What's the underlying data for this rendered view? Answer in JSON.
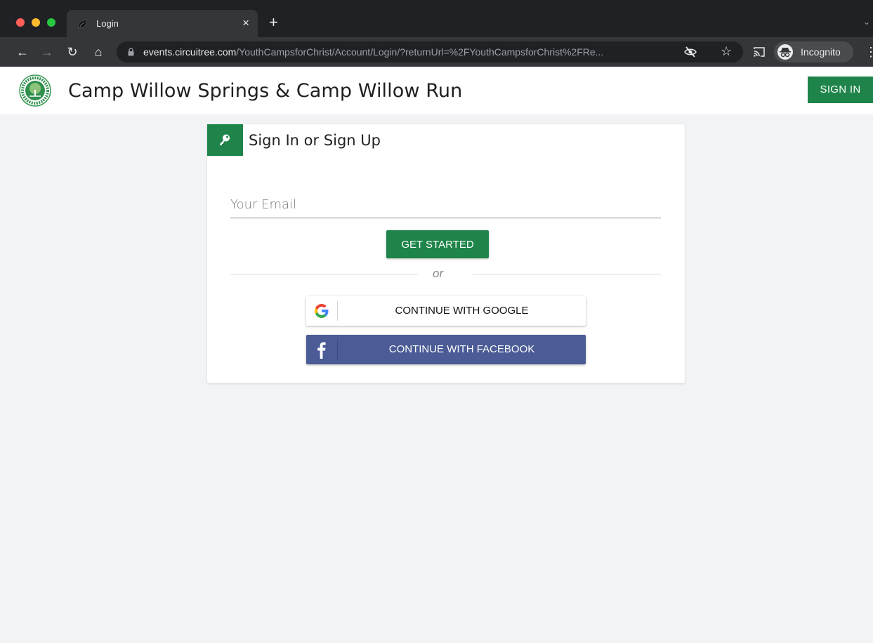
{
  "browser": {
    "tab_title": "Login",
    "tab_close": "×",
    "new_tab": "+",
    "url_host": "events.circuitree.com",
    "url_path": "/YouthCampsforChrist/Account/Login/?returnUrl=%2FYouthCampsforChrist%2FRe...",
    "incognito_label": "Incognito"
  },
  "header": {
    "site_title": "Camp Willow Springs & Camp Willow Run",
    "signin_label": "SIGN IN",
    "logo_icon": "youth-camps-for-christ-logo"
  },
  "card": {
    "title": "Sign In or Sign Up",
    "email_placeholder": "Your Email",
    "get_started_label": "GET STARTED",
    "divider_text": "or",
    "google_label": "CONTINUE WITH GOOGLE",
    "facebook_label": "CONTINUE WITH FACEBOOK"
  },
  "colors": {
    "brand_green": "#1e8449",
    "facebook_blue": "#4a5b95",
    "page_bg": "#f2f3f5"
  }
}
